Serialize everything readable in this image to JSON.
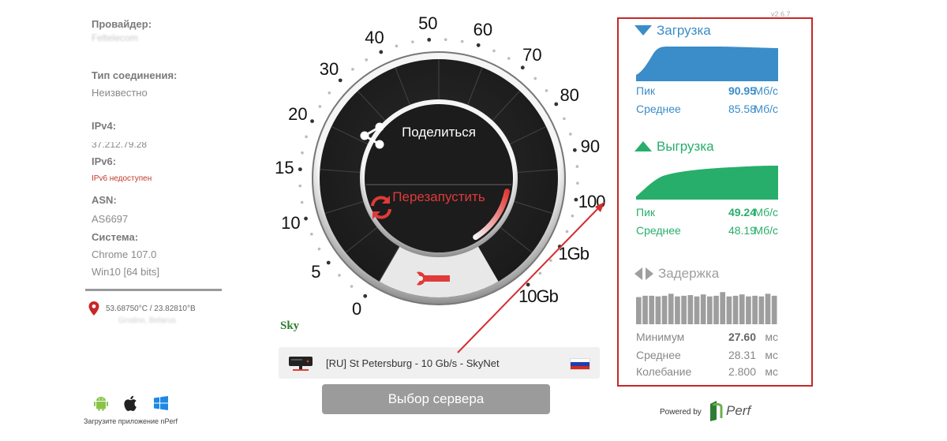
{
  "info": {
    "provider_label": "Провайдер:",
    "provider_value": "Feltelecom",
    "connection_label": "Тип соединения:",
    "connection_value": "Неизвестно",
    "ipv4_label": "IPv4:",
    "ipv4_value": "37.212.79.28",
    "ipv6_label": "IPv6:",
    "ipv6_value": "IPv6 недоступен",
    "asn_label": "ASN:",
    "asn_value": "AS6697",
    "system_label": "Система:",
    "browser": "Chrome 107.0",
    "os": "Win10 [64 bits]",
    "coordinates": "53.68750°С / 23.82810°В",
    "location_blur": "Grodno, Belarus"
  },
  "apps": {
    "caption": "Загрузите приложение nPerf",
    "icons": [
      "android-icon",
      "apple-icon",
      "windows-icon"
    ]
  },
  "gauge": {
    "ticks": [
      "0",
      "5",
      "10",
      "15",
      "20",
      "30",
      "40",
      "50",
      "60",
      "70",
      "80",
      "90",
      "100",
      "1Gb",
      "10Gb"
    ],
    "share_label": "Поделиться",
    "restart_label": "Перезапустить",
    "progress": 0.35
  },
  "server": {
    "name": "[RU] St Petersburg - 10 Gb/s - SkyNet",
    "choose_label": "Выбор сервера",
    "sponsor": "Sky"
  },
  "version": "v2.6.7",
  "results": {
    "download": {
      "title": "Загрузка",
      "color": "#3a8dc8",
      "peak_label": "Пик",
      "peak_value": "90.95",
      "avg_label": "Среднее",
      "avg_value": "85.58",
      "unit": "Мб/с"
    },
    "upload": {
      "title": "Выгрузка",
      "color": "#27ae6b",
      "peak_label": "Пик",
      "peak_value": "49.24",
      "avg_label": "Среднее",
      "avg_value": "48.19",
      "unit": "Мб/с"
    },
    "latency": {
      "title": "Задержка",
      "color": "#9e9e9e",
      "min_label": "Минимум",
      "min_value": "27.60",
      "avg_label": "Среднее",
      "avg_value": "28.31",
      "jitter_label": "Колебание",
      "jitter_value": "2.800",
      "unit": "мс"
    }
  },
  "footer": {
    "powered_by": "Powered by",
    "brand": "nPerf"
  }
}
